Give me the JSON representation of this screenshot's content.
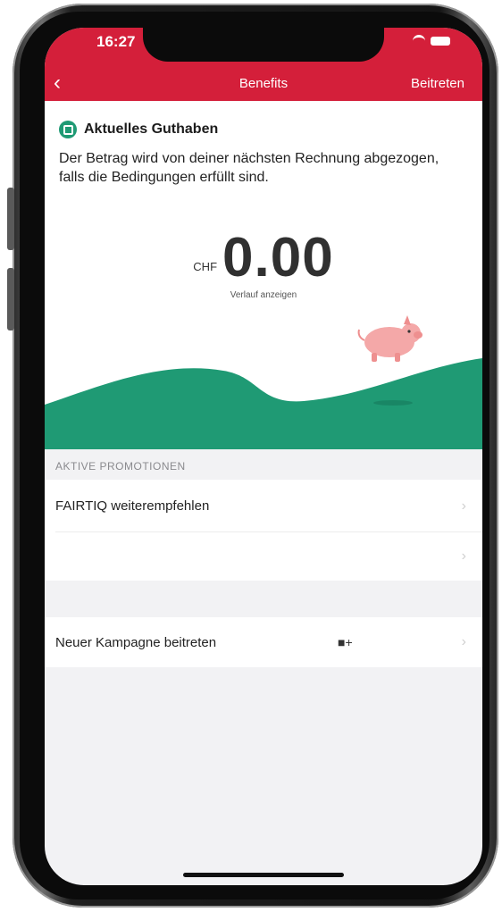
{
  "status_bar": {
    "time": "16:27"
  },
  "nav": {
    "back_icon": "‹",
    "title": "Benefits",
    "action_label": "Beitreten"
  },
  "credit_card": {
    "icon": "credit-icon",
    "title": "Aktuelles Guthaben",
    "description": "Der Betrag wird von deiner nächsten Rechnung abgezogen, falls die Bedingungen erfüllt sind.",
    "currency": "CHF",
    "amount": "0.00",
    "history_link": "Verlauf anzeigen",
    "wave_color": "#1f9a74"
  },
  "promotions": {
    "section_title": "AKTIVE PROMOTIONEN",
    "items": [
      {
        "label": "FAIRTIQ weiterempfehlen",
        "chevron": "›"
      },
      {
        "label": "",
        "chevron": "›"
      }
    ]
  },
  "join_campaign": {
    "label": "Neuer Kampagne beitreten",
    "icon": "camera-plus-icon",
    "icon_glyph": "■+",
    "chevron": "›"
  },
  "colors": {
    "brand_red": "#d41f3a",
    "accent_green": "#1f9a74"
  }
}
